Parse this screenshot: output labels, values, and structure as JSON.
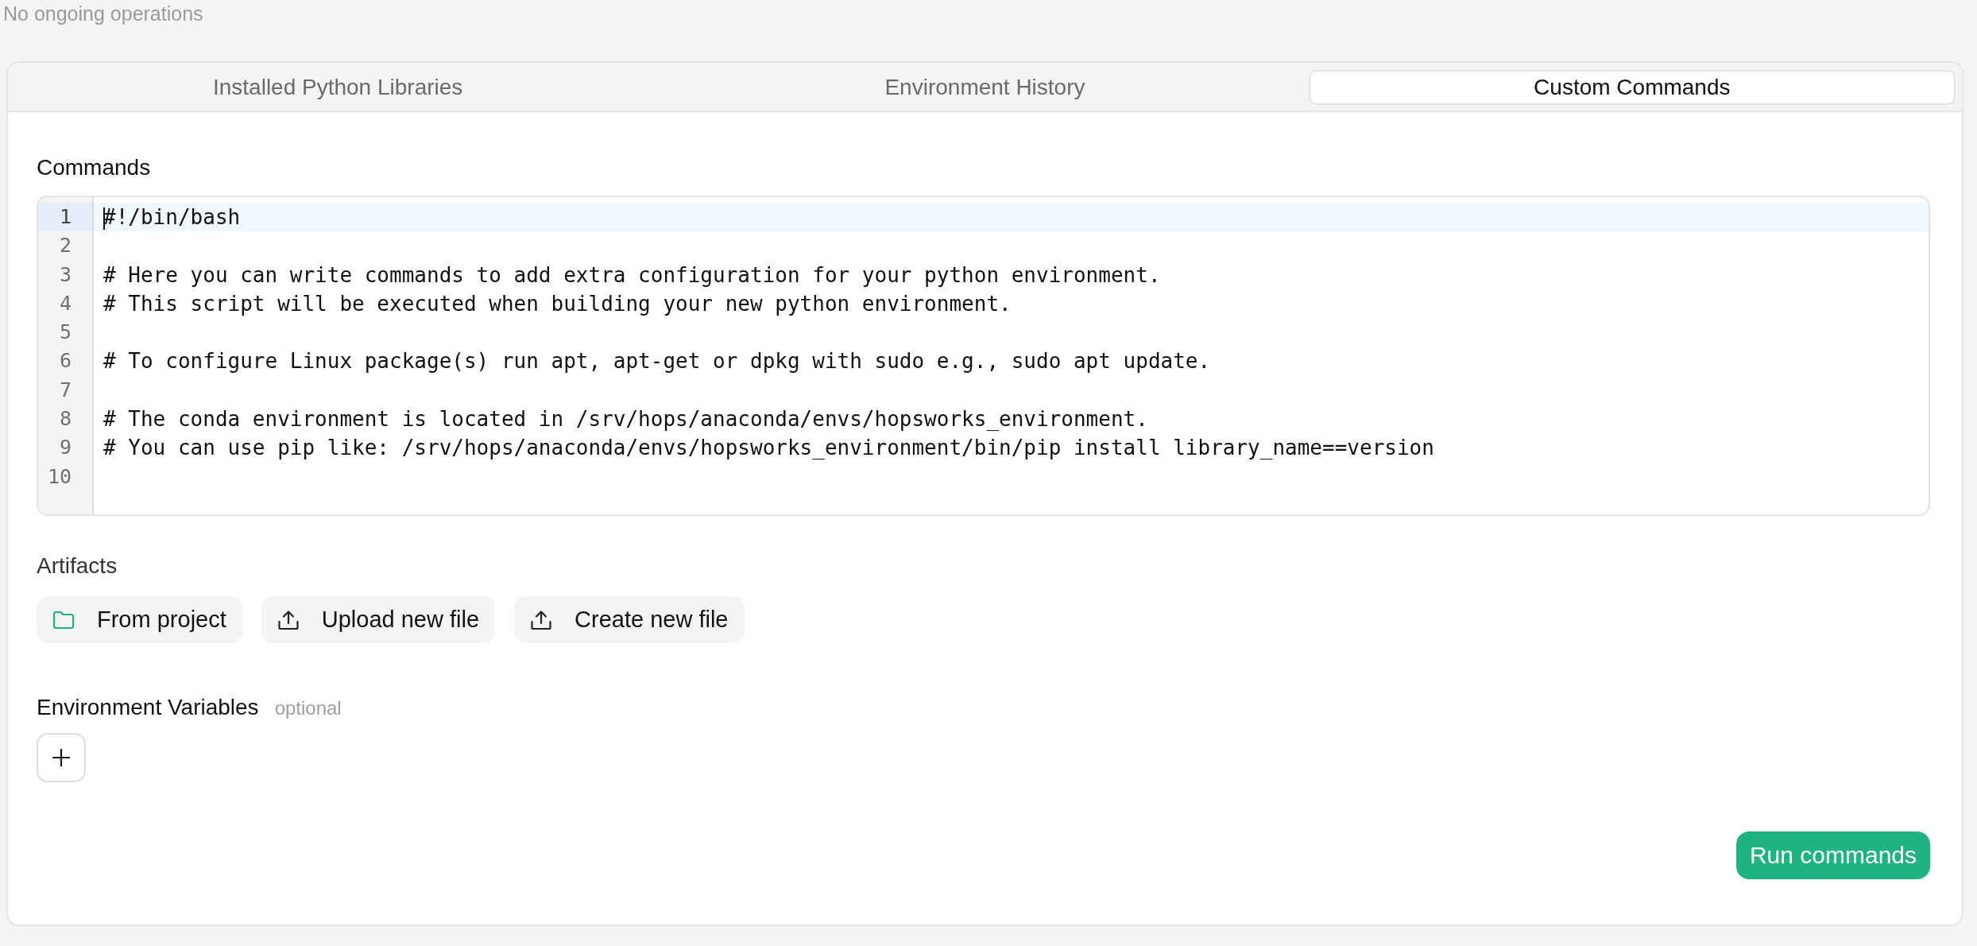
{
  "status": "No ongoing operations",
  "tabs": [
    {
      "label": "Installed Python Libraries",
      "selected": false
    },
    {
      "label": "Environment History",
      "selected": false
    },
    {
      "label": "Custom Commands",
      "selected": true
    }
  ],
  "commands": {
    "label": "Commands",
    "editor": {
      "lines": [
        {
          "number": "1",
          "text": "#!/bin/bash",
          "active": true
        },
        {
          "number": "2",
          "active": false
        },
        {
          "number": "3",
          "text": "# Here you can write commands to add extra configuration for your python environment.",
          "active": false
        },
        {
          "number": "4",
          "text": "# This script will be executed when building your new python environment.",
          "active": false
        },
        {
          "number": "5",
          "active": false
        },
        {
          "number": "6",
          "text": "# To configure Linux package(s) run apt, apt-get or dpkg with sudo e.g., sudo apt update.",
          "active": false
        },
        {
          "number": "7",
          "active": false
        },
        {
          "number": "8",
          "text": "# The conda environment is located in /srv/hops/anaconda/envs/hopsworks_environment.",
          "active": false
        },
        {
          "number": "9",
          "text": "# You can use pip like: /srv/hops/anaconda/envs/hopsworks_environment/bin/pip install library_name==version",
          "active": false
        },
        {
          "number": "10",
          "active": false
        }
      ]
    }
  },
  "artifacts": {
    "label": "Artifacts",
    "buttons": [
      {
        "label": "From project",
        "kind": "browse"
      },
      {
        "label": "Upload new file",
        "kind": "upload"
      },
      {
        "label": "Create new file",
        "kind": "create"
      }
    ]
  },
  "environment_variables": {
    "label": "Environment Variables",
    "hint": "optional"
  },
  "run_button": {
    "label": "Run commands"
  }
}
